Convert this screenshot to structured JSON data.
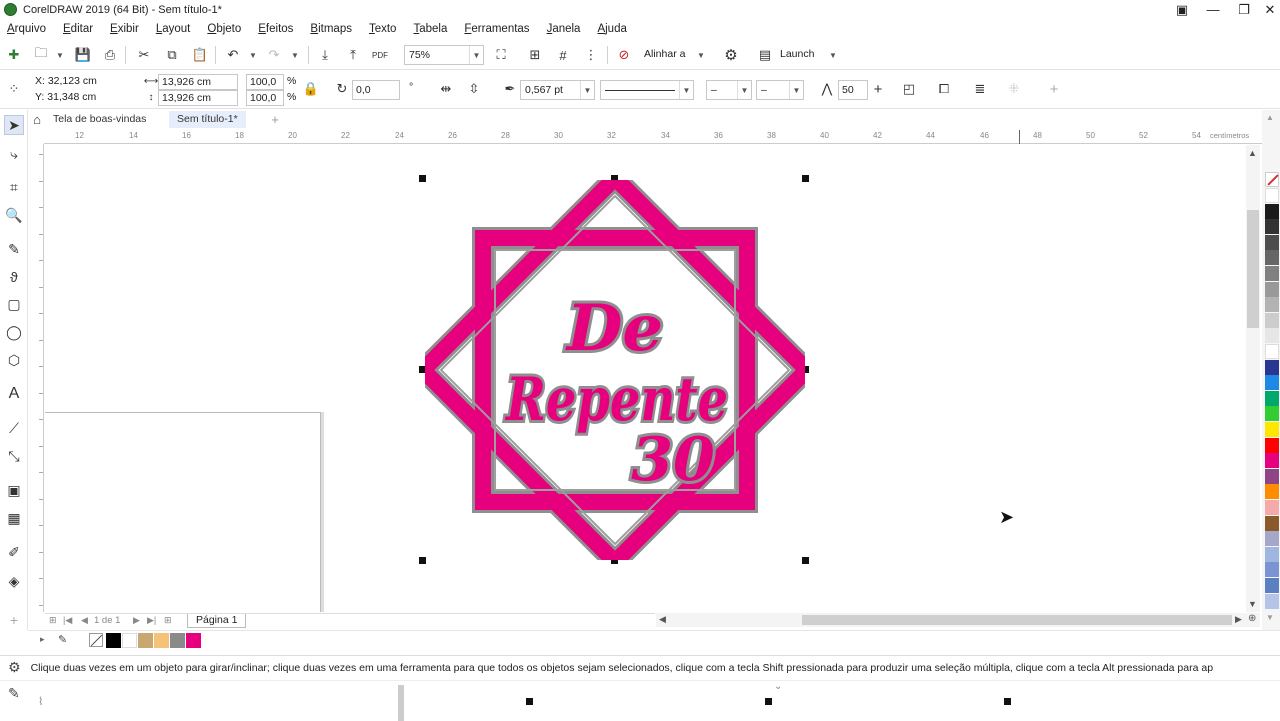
{
  "window": {
    "title": "CorelDRAW 2019 (64 Bit) - Sem título-1*",
    "controls": [
      "minimize",
      "maximize",
      "close"
    ]
  },
  "menu": [
    "Arquivo",
    "Editar",
    "Exibir",
    "Layout",
    "Objeto",
    "Efeitos",
    "Bitmaps",
    "Texto",
    "Tabela",
    "Ferramentas",
    "Janela",
    "Ajuda"
  ],
  "standard_toolbar": {
    "zoom": "75%",
    "align_label": "Alinhar a",
    "launch_label": "Launch",
    "pdf_label": "PDF"
  },
  "property_bar": {
    "x": "X: 32,123 cm",
    "y": "Y: 31,348 cm",
    "width": "13,926 cm",
    "height": "13,926 cm",
    "scale_w": "100,0",
    "scale_h": "100,0",
    "pct": "%",
    "rotation": "0,0",
    "degree": "°",
    "outline_width": "0,567 pt",
    "dash": "–",
    "miter": "50"
  },
  "doc_tabs": [
    "Tela de boas-vindas",
    "Sem título-1*"
  ],
  "ruler": {
    "numbers": [
      "12",
      "14",
      "16",
      "18",
      "20",
      "22",
      "24",
      "26",
      "28",
      "30",
      "32",
      "34",
      "36",
      "38",
      "40",
      "42",
      "44",
      "46",
      "48",
      "50",
      "52",
      "54"
    ],
    "unit": "centímetros"
  },
  "artwork": {
    "line1": "De",
    "line2": "Repente",
    "line3": "30",
    "color_primary": "#e6007e",
    "color_outline": "#8f8f8f"
  },
  "page_nav": {
    "counter": "1 de 1",
    "page_tab": "Página 1"
  },
  "palette_colors": [
    "#ffffff",
    "#1a1a1a",
    "#333333",
    "#4d4d4d",
    "#666666",
    "#808080",
    "#999999",
    "#b3b3b3",
    "#cccccc",
    "#e6e6e6",
    "#ffffff",
    "#283593",
    "#1e88e5",
    "#00a86b",
    "#32cd32",
    "#ffe600",
    "#ff0000",
    "#e6007e",
    "#8e4585",
    "#ff8c00",
    "#f5a9a9",
    "#8b5a2b",
    "#a6a6c8",
    "#9fb6e0",
    "#7b93d3",
    "#5c7fc2",
    "#b5c3e8"
  ],
  "doc_palette_colors": [
    "#000000",
    "#ffffff",
    "#c8a870",
    "#f5c27a",
    "#8a8a8a",
    "#e6007e"
  ],
  "status": {
    "message": "Clique duas vezes em um objeto para girar/inclinar; clique duas vezes em uma ferramenta para que todos os objetos sejam selecionados, clique com a tecla Shift pressionada para produzir uma seleção múltipla, clique com a tecla Alt pressionada para ap"
  }
}
